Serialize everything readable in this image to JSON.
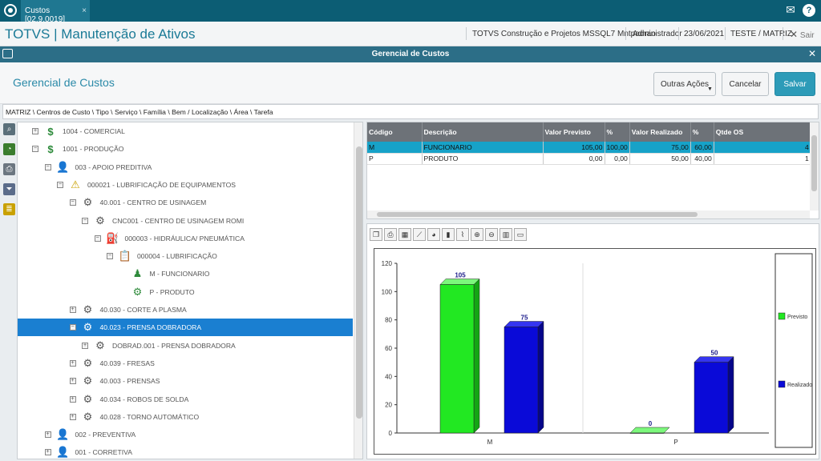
{
  "tabs": {
    "active_label": "Custos [02.9.0019]",
    "close": "×"
  },
  "header": {
    "app_title": "TOTVS | Manutenção de Ativos",
    "company": "TOTVS Construção e Projetos MSSQL7 Mntpadrao",
    "user": "Administrador",
    "date": "23/06/2021",
    "environment": "TESTE / MATRIZ",
    "exit_label": "Sair"
  },
  "window": {
    "title": "Gerencial de Custos"
  },
  "page": {
    "title": "Gerencial de Custos",
    "buttons": {
      "other_actions": "Outras Ações",
      "cancel": "Cancelar",
      "save": "Salvar"
    }
  },
  "breadcrumb": "MATRIZ \\ Centros de Custo \\ Tipo \\ Serviço \\ Família \\ Bem / Localização \\ Área \\ Tarefa",
  "tree": [
    {
      "label": "1004 - COMERCIAL",
      "icon": "money-icon",
      "depth": 0,
      "sign": "+"
    },
    {
      "label": "1001 - PRODUÇÃO",
      "icon": "money-icon",
      "depth": 0,
      "sign": "−"
    },
    {
      "label": "003 - APOIO PREDITIVA",
      "icon": "person-icon",
      "depth": 1,
      "sign": "−"
    },
    {
      "label": "000021 - LUBRIFICAÇÃO DE EQUIPAMENTOS",
      "icon": "warning-icon",
      "depth": 2,
      "sign": "−"
    },
    {
      "label": "40.001 - CENTRO DE USINAGEM",
      "icon": "gears-icon",
      "depth": 3,
      "sign": "−"
    },
    {
      "label": "CNC001 - CENTRO DE USINAGEM ROMI",
      "icon": "gear-icon",
      "depth": 4,
      "sign": "−"
    },
    {
      "label": "000003 - HIDRÁULICA/ PNEUMÁTICA",
      "icon": "oil-can-icon",
      "depth": 5,
      "sign": "−"
    },
    {
      "label": "000004 - LUBRIFICAÇÃO",
      "icon": "clipboard-icon",
      "depth": 6,
      "sign": "−"
    },
    {
      "label": "M - FUNCIONARIO",
      "icon": "group-person-icon",
      "depth": 7,
      "sign": ""
    },
    {
      "label": "P - PRODUTO",
      "icon": "group-gear-icon",
      "depth": 7,
      "sign": ""
    },
    {
      "label": "40.030 - CORTE A PLASMA",
      "icon": "gears-icon",
      "depth": 3,
      "sign": "+"
    },
    {
      "label": "40.023 - PRENSA DOBRADORA",
      "icon": "gears-icon",
      "depth": 3,
      "sign": "−",
      "selected": true
    },
    {
      "label": "DOBRAD.001 - PRENSA DOBRADORA",
      "icon": "gear-icon",
      "depth": 4,
      "sign": "+"
    },
    {
      "label": "40.039 - FRESAS",
      "icon": "gears-icon",
      "depth": 3,
      "sign": "+"
    },
    {
      "label": "40.003 - PRENSAS",
      "icon": "gears-icon",
      "depth": 3,
      "sign": "+"
    },
    {
      "label": "40.034 - ROBOS DE SOLDA",
      "icon": "gears-icon",
      "depth": 3,
      "sign": "+"
    },
    {
      "label": "40.028 - TORNO AUTOMÁTICO",
      "icon": "gears-icon",
      "depth": 3,
      "sign": "+"
    },
    {
      "label": "002 - PREVENTIVA",
      "icon": "person-icon",
      "depth": 1,
      "sign": "+"
    },
    {
      "label": "001 - CORRETIVA",
      "icon": "person-icon",
      "depth": 1,
      "sign": "+"
    }
  ],
  "grid": {
    "columns": [
      "Código",
      "Descrição",
      "Valor Previsto",
      "%",
      "Valor Realizado",
      "%",
      "Qtde OS"
    ],
    "rows": [
      [
        "M",
        "FUNCIONARIO",
        "105,00",
        "100,00",
        "75,00",
        "60,00",
        "4"
      ],
      [
        "P",
        "PRODUTO",
        "0,00",
        "0,00",
        "50,00",
        "40,00",
        "1"
      ]
    ]
  },
  "chart_data": {
    "type": "bar",
    "categories": [
      "M",
      "P"
    ],
    "series": [
      {
        "name": "Previsto",
        "values": [
          105,
          0
        ],
        "color": "#22e822"
      },
      {
        "name": "Realizado",
        "values": [
          75,
          50
        ],
        "color": "#0a0ad8"
      }
    ],
    "yticks": [
      "0",
      "20",
      "40",
      "60",
      "80",
      "100",
      "120"
    ],
    "ylim": [
      0,
      120
    ],
    "data_labels": [
      "105",
      "75",
      "0",
      "50"
    ],
    "legend_position": "right",
    "grid": false
  }
}
